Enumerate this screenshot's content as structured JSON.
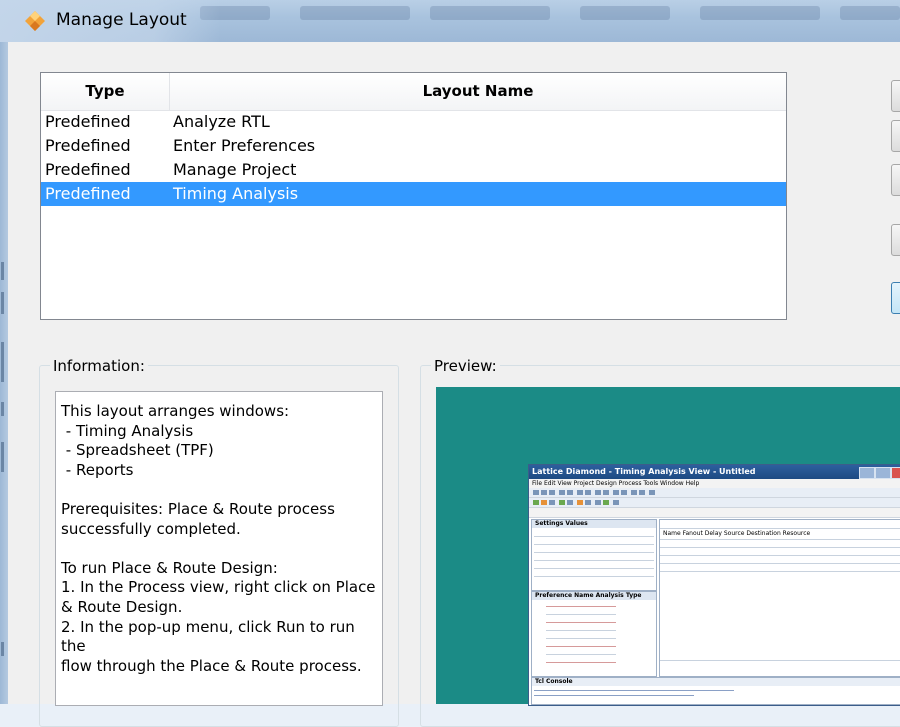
{
  "window": {
    "title": "Manage Layout"
  },
  "table": {
    "columns": [
      "Type",
      "Layout Name"
    ],
    "rows": [
      {
        "type": "Predefined",
        "name": "Analyze RTL",
        "selected": false
      },
      {
        "type": "Predefined",
        "name": "Enter Preferences",
        "selected": false
      },
      {
        "type": "Predefined",
        "name": "Manage Project",
        "selected": false
      },
      {
        "type": "Predefined",
        "name": "Timing Analysis",
        "selected": true
      }
    ]
  },
  "information": {
    "label": "Information:",
    "text": "This layout arranges windows:\n - Timing Analysis\n - Spreadsheet (TPF)\n - Reports\n\nPrerequisites: Place & Route process\nsuccessfully completed.\n\nTo run Place & Route Design:\n1. In the Process view, right click on Place\n& Route Design.\n2. In the pop-up menu, click Run to run the\nflow through the Place & Route process."
  },
  "preview": {
    "label": "Preview:",
    "background": "#1b8b86",
    "mini": {
      "title": "Lattice Diamond - Timing Analysis View - Untitled",
      "menu": "File  Edit  View  Project  Design  Process  Tools  Window  Help",
      "left_header": "Settings      Values",
      "pref_header": "Preference Name    Analysis Type",
      "right_header": "Name  Fanout  Delay  Source  Destination  Resource",
      "console": "Tcl Console"
    }
  },
  "colors": {
    "selection": "#3399ff",
    "client": "#f0f0f0",
    "accent_blue": "#3399ff"
  }
}
